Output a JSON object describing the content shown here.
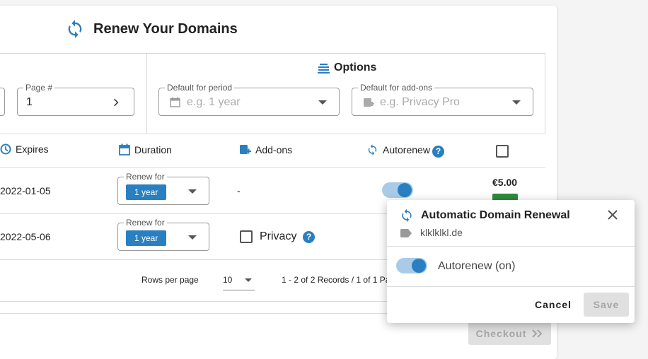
{
  "header": {
    "title": "Renew Your Domains"
  },
  "filters": {
    "page_label": "Page #",
    "page_value": "1",
    "options_title": "Options",
    "default_period_label": "Default for period",
    "default_period_placeholder": "e.g. 1 year",
    "default_addons_label": "Default for add-ons",
    "default_addons_placeholder": "e.g. Privacy Pro"
  },
  "table": {
    "headers": {
      "expires": "Expires",
      "duration": "Duration",
      "addons": "Add-ons",
      "autorenew": "Autorenew"
    },
    "rows": [
      {
        "expires": "2022-01-05",
        "renew_label": "Renew for",
        "renew_value": "1 year",
        "addons": "-",
        "price": "€5.00"
      },
      {
        "expires": "2022-05-06",
        "renew_label": "Renew for",
        "renew_value": "1 year",
        "addons": "Privacy"
      }
    ]
  },
  "pagination": {
    "rows_per_page_label": "Rows per page",
    "rows_per_page_value": "10",
    "records": "1 - 2 of 2 Records / 1 of 1 Pa"
  },
  "checkout": {
    "label": "Checkout"
  },
  "popup": {
    "title": "Automatic Domain Renewal",
    "domain": "klklklkl.de",
    "toggle_label": "Autorenew (on)",
    "cancel_label": "Cancel",
    "save_label": "Save"
  },
  "colors": {
    "accent": "#2a7fc1",
    "accent_light": "#a9cbe8",
    "disabled_bg": "#e0e0e0",
    "green": "#2e8b3a"
  },
  "icons": [
    "refresh-icon",
    "options-icon",
    "calendar-icon",
    "addons-icon",
    "clock-icon",
    "tag-icon",
    "close-icon",
    "chevron-right-icon",
    "double-chevron-icon"
  ]
}
